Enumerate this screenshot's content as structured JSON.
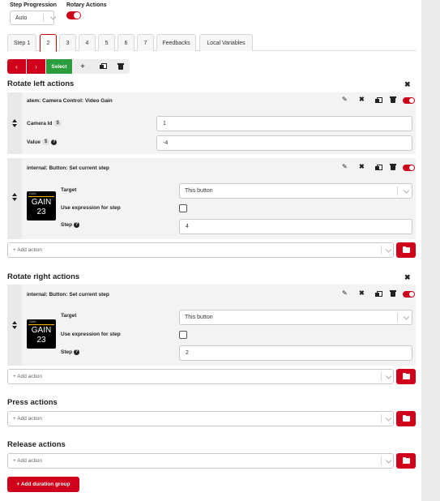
{
  "header": {
    "step_progression_label": "Step Progression",
    "step_progression_value": "Auto",
    "rotary_actions_label": "Rotary Actions",
    "rotary_actions_enabled": true
  },
  "tabs": [
    {
      "label": "Step 1",
      "active": false
    },
    {
      "label": "2",
      "active": true
    },
    {
      "label": "3",
      "active": false
    },
    {
      "label": "4",
      "active": false
    },
    {
      "label": "5",
      "active": false
    },
    {
      "label": "6",
      "active": false
    },
    {
      "label": "7",
      "active": false
    },
    {
      "label": "Feedbacks",
      "active": false
    },
    {
      "label": "Local Variables",
      "active": false
    }
  ],
  "toolbar": {
    "prev_icon": "chevron-left-icon",
    "next_icon": "chevron-right-icon",
    "select_label": "Select",
    "add_icon": "plus-icon",
    "duplicate_icon": "copy-icon",
    "delete_icon": "trash-icon"
  },
  "rotate_left": {
    "title": "Rotate left actions",
    "actions": [
      {
        "title": "atem: Camera Control: Video Gain",
        "fields": [
          {
            "label": "Camera Id",
            "badge": "$",
            "value": "1"
          },
          {
            "label": "Value",
            "badge": "$",
            "help": "?",
            "value": "-4"
          }
        ]
      },
      {
        "title": "internal: Button: Set current step",
        "thumb": {
          "small": "GAIN",
          "line1": "GAIN",
          "line2": "23"
        },
        "target_label": "Target",
        "target_value": "This button",
        "use_expr_label": "Use expression for step",
        "step_label": "Step",
        "step_help": "?",
        "step_value": "4"
      }
    ],
    "add_action_placeholder": "+ Add action"
  },
  "rotate_right": {
    "title": "Rotate right actions",
    "action": {
      "title": "internal: Button: Set current step",
      "thumb": {
        "small": "GAIN",
        "line1": "GAIN",
        "line2": "23"
      },
      "target_label": "Target",
      "target_value": "This button",
      "use_expr_label": "Use expression for step",
      "step_label": "Step",
      "step_help": "?",
      "step_value": "2"
    },
    "add_action_placeholder": "+ Add action"
  },
  "press": {
    "title": "Press actions",
    "add_action_placeholder": "+ Add action"
  },
  "release": {
    "title": "Release actions",
    "add_action_placeholder": "+ Add action"
  },
  "add_duration_group_label": "+ Add duration group",
  "colors": {
    "accent": "#d0021b",
    "select_green": "#2a9d3c"
  }
}
